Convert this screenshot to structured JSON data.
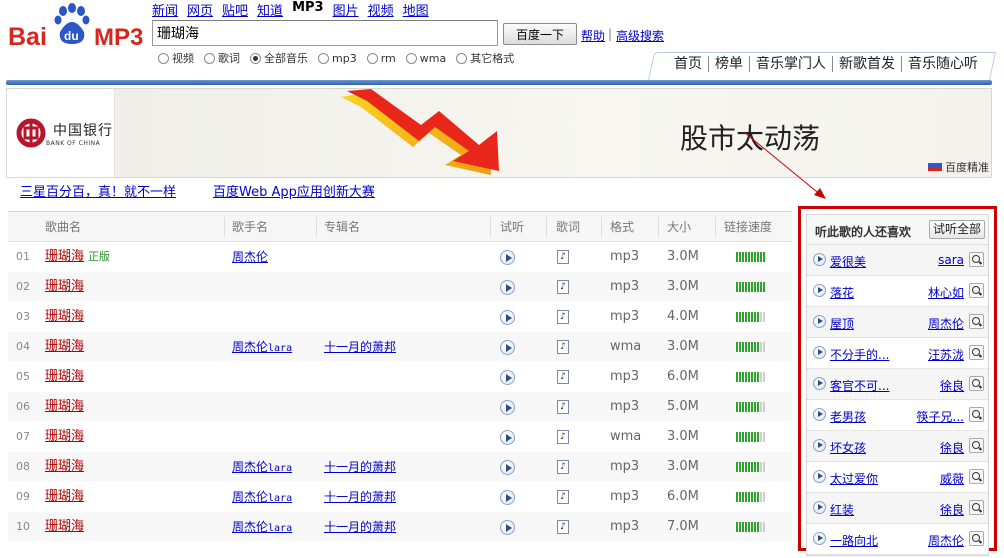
{
  "logo": {
    "text_baidu_a": "Bai",
    "text_du": "du",
    "text_mp3": "MP3",
    "color_red": "#d9261c",
    "color_blue": "#2a56c6"
  },
  "topnav": [
    {
      "label": "新闻",
      "current": false
    },
    {
      "label": "网页",
      "current": false
    },
    {
      "label": "贴吧",
      "current": false
    },
    {
      "label": "知道",
      "current": false
    },
    {
      "label": "MP3",
      "current": true
    },
    {
      "label": "图片",
      "current": false
    },
    {
      "label": "视频",
      "current": false
    },
    {
      "label": "地图",
      "current": false
    }
  ],
  "search": {
    "value": "珊瑚海",
    "button_label": "百度一下",
    "help_label": "帮助",
    "separator": "|",
    "advanced_label": "高级搜索"
  },
  "formats": [
    {
      "label": "视频",
      "checked": false
    },
    {
      "label": "歌词",
      "checked": false
    },
    {
      "label": "全部音乐",
      "checked": true
    },
    {
      "label": "mp3",
      "checked": false
    },
    {
      "label": "rm",
      "checked": false
    },
    {
      "label": "wma",
      "checked": false
    },
    {
      "label": "其它格式",
      "checked": false
    }
  ],
  "subnav": [
    "首页",
    "榜单",
    "音乐掌门人",
    "新歌首发",
    "音乐随心听"
  ],
  "banner": {
    "bank_name_cn": "中国银行",
    "bank_name_en": "BANK OF CHINA",
    "slogan": "股市太动荡",
    "ad_label": "百度精准"
  },
  "promos": [
    "三星百分百，真！就不一样",
    "百度Web App应用创新大赛"
  ],
  "table": {
    "headers": {
      "song": "歌曲名",
      "singer": "歌手名",
      "album": "专辑名",
      "listen": "试听",
      "lyrics": "歌词",
      "format": "格式",
      "size": "大小",
      "speed": "链接速度"
    },
    "rows": [
      {
        "num": "01",
        "song": "珊瑚海",
        "tag": "正版",
        "singer": "周杰伦",
        "singer_suffix": "",
        "album": "",
        "format": "mp3",
        "size": "3.0M",
        "speed": 10
      },
      {
        "num": "02",
        "song": "珊瑚海",
        "tag": "",
        "singer": "",
        "singer_suffix": "",
        "album": "",
        "format": "mp3",
        "size": "3.0M",
        "speed": 10
      },
      {
        "num": "03",
        "song": "珊瑚海",
        "tag": "",
        "singer": "",
        "singer_suffix": "",
        "album": "",
        "format": "mp3",
        "size": "4.0M",
        "speed": 8
      },
      {
        "num": "04",
        "song": "珊瑚海",
        "tag": "",
        "singer": "周杰伦",
        "singer_suffix": "lara",
        "album": "十一月的萧邦",
        "format": "wma",
        "size": "3.0M",
        "speed": 8
      },
      {
        "num": "05",
        "song": "珊瑚海",
        "tag": "",
        "singer": "",
        "singer_suffix": "",
        "album": "",
        "format": "mp3",
        "size": "6.0M",
        "speed": 8
      },
      {
        "num": "06",
        "song": "珊瑚海",
        "tag": "",
        "singer": "",
        "singer_suffix": "",
        "album": "",
        "format": "mp3",
        "size": "5.0M",
        "speed": 8
      },
      {
        "num": "07",
        "song": "珊瑚海",
        "tag": "",
        "singer": "",
        "singer_suffix": "",
        "album": "",
        "format": "wma",
        "size": "3.0M",
        "speed": 8
      },
      {
        "num": "08",
        "song": "珊瑚海",
        "tag": "",
        "singer": "周杰伦",
        "singer_suffix": "lara",
        "album": "十一月的萧邦",
        "format": "mp3",
        "size": "3.0M",
        "speed": 8
      },
      {
        "num": "09",
        "song": "珊瑚海",
        "tag": "",
        "singer": "周杰伦",
        "singer_suffix": "lara",
        "album": "十一月的萧邦",
        "format": "mp3",
        "size": "6.0M",
        "speed": 8
      },
      {
        "num": "10",
        "song": "珊瑚海",
        "tag": "",
        "singer": "周杰伦",
        "singer_suffix": "lara",
        "album": "十一月的萧邦",
        "format": "mp3",
        "size": "7.0M",
        "speed": 8
      }
    ]
  },
  "recommend": {
    "title": "听此歌的人还喜欢",
    "listen_all_label": "试听全部",
    "items": [
      {
        "song": "爱很美",
        "singer": "sara"
      },
      {
        "song": "落花",
        "singer": "林心如"
      },
      {
        "song": "屋顶",
        "singer": "周杰伦"
      },
      {
        "song": "不分手的...",
        "singer": "汪苏泷"
      },
      {
        "song": "客官不可...",
        "singer": "徐良"
      },
      {
        "song": "老男孩",
        "singer": "筷子兄..."
      },
      {
        "song": "坏女孩",
        "singer": "徐良"
      },
      {
        "song": "太过爱你",
        "singer": "威薇"
      },
      {
        "song": "红装",
        "singer": "徐良"
      },
      {
        "song": "一路向北",
        "singer": "周杰伦"
      }
    ]
  },
  "colors": {
    "song_link": "#b10000",
    "link": "#0000cc",
    "highlight_border": "#cc0000",
    "speed_bar": "#2fa32f",
    "header_bar": "#2f5fad"
  },
  "icons": [
    "baidu-paw-icon",
    "play-icon",
    "lyrics-icon",
    "search-icon",
    "bank-of-china-logo-icon",
    "flag-icon"
  ]
}
